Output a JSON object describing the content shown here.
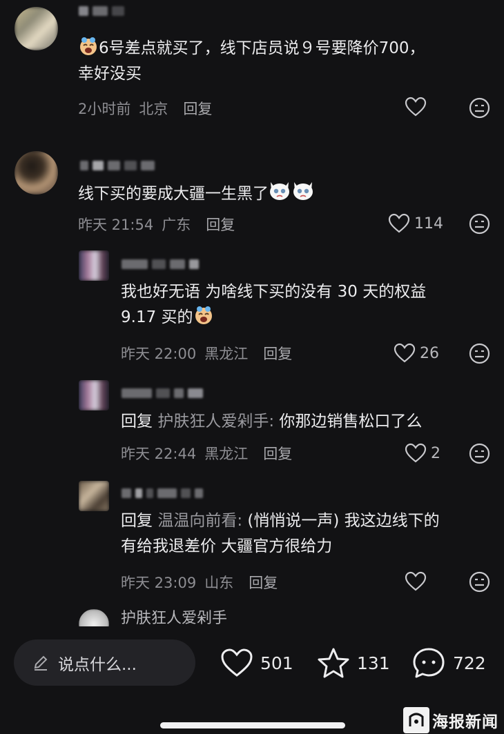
{
  "comments": [
    {
      "text_lines": [
        "6号差点就买了，线下店员说９号要降价700，",
        "幸好没买"
      ],
      "time": "2小时前",
      "location": "北京",
      "reply": "回复",
      "likes": ""
    },
    {
      "text_lines": [
        "线下买的要成大疆一生黑了"
      ],
      "time": "昨天 21:54",
      "location": "广东",
      "reply": "回复",
      "likes": "114"
    },
    {
      "text_lines": [
        "我也好无语 为啥线下买的没有 30 天的权益",
        "9.17 买的"
      ],
      "time": "昨天 22:00",
      "location": "黑龙江",
      "reply": "回复",
      "likes": "26"
    },
    {
      "reply_prefix": "回复 ",
      "reply_target": "护肤狂人爱剁手: ",
      "text_lines": [
        "你那边销售松口了么"
      ],
      "time": "昨天 22:44",
      "location": "黑龙江",
      "reply": "回复",
      "likes": "2"
    },
    {
      "reply_prefix": "回复 ",
      "reply_target": "温温向前看: ",
      "text_lines": [
        "(悄悄说一声) 我这边线下的",
        "有给我退差价 大疆官方很给力"
      ],
      "time": "昨天 23:09",
      "location": "山东",
      "reply": "回复",
      "likes": ""
    },
    {
      "username": "护肤狂人爱剁手"
    }
  ],
  "bottom_bar": {
    "input_placeholder": "说点什么...",
    "likes": "501",
    "favorites": "131",
    "comments": "722"
  },
  "watermark": {
    "name": "海报新闻"
  },
  "colors": {
    "background": "#121214",
    "text": "#ececee",
    "meta": "#8e8e93"
  }
}
